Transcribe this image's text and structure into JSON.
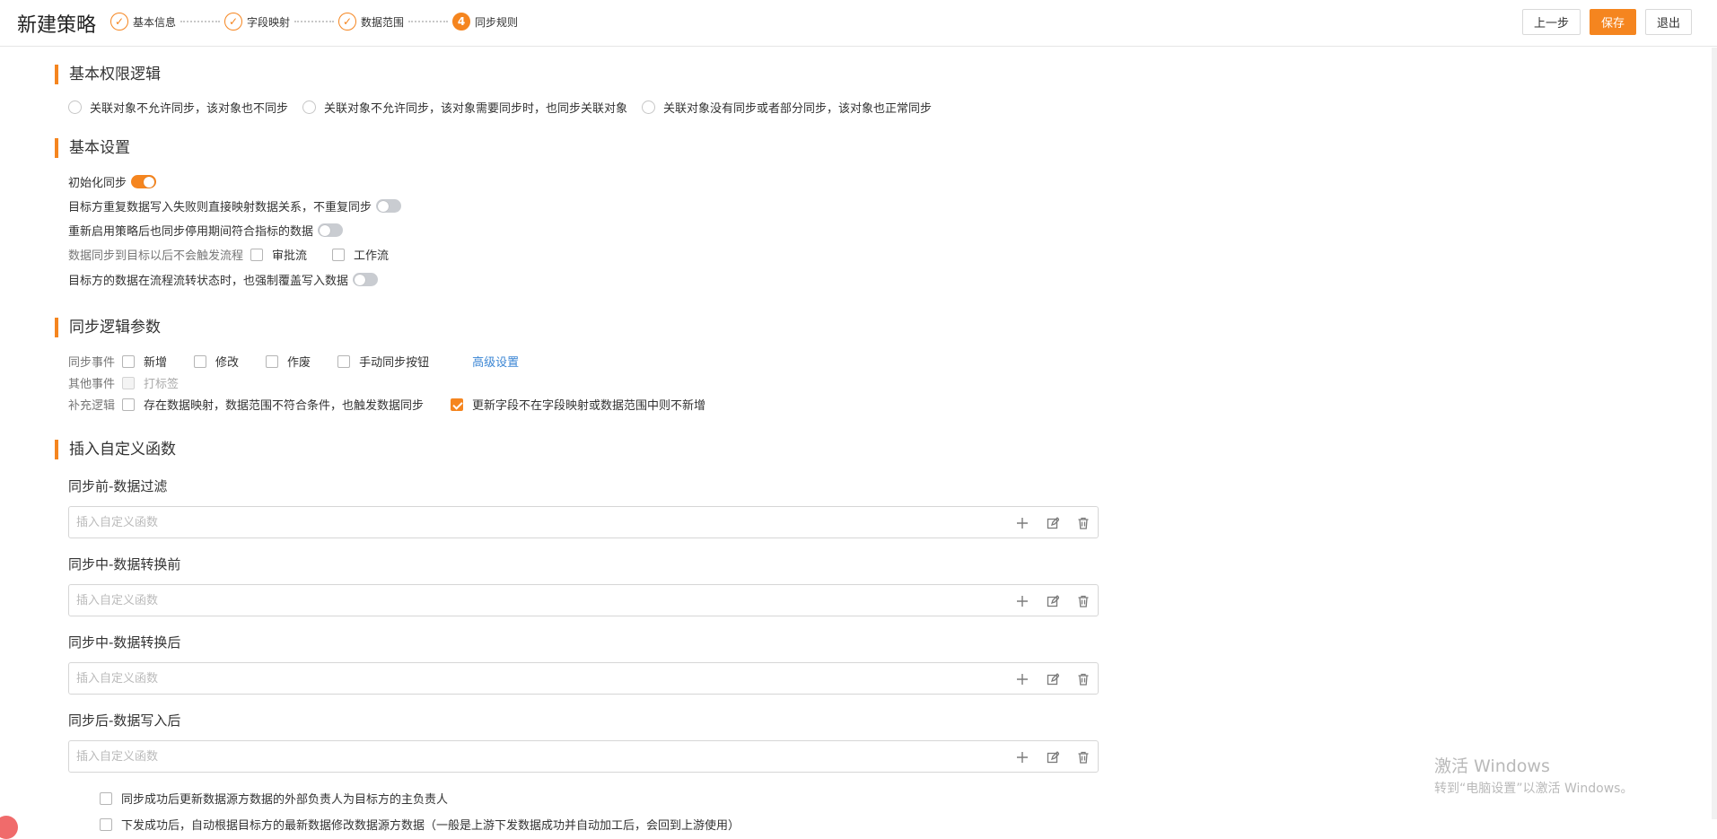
{
  "header": {
    "title": "新建策略",
    "steps": [
      {
        "label": "基本信息",
        "state": "done"
      },
      {
        "label": "字段映射",
        "state": "done"
      },
      {
        "label": "数据范围",
        "state": "done"
      },
      {
        "label": "同步规则",
        "state": "active",
        "number": "4"
      }
    ],
    "buttons": {
      "prev": "上一步",
      "save": "保存",
      "exit": "退出"
    }
  },
  "permission": {
    "title": "基本权限逻辑",
    "options": [
      "关联对象不允许同步，该对象也不同步",
      "关联对象不允许同步，该对象需要同步时，也同步关联对象",
      "关联对象没有同步或者部分同步，该对象也正常同步"
    ]
  },
  "basic": {
    "title": "基本设置",
    "init_sync": "初始化同步",
    "init_sync_on": true,
    "target_retry": "目标方重复数据写入失败则直接映射数据关系，不重复同步",
    "target_retry_on": false,
    "restart_sync": "重新启用策略后也同步停用期间符合指标的数据",
    "restart_sync_on": false,
    "no_flow": "数据同步到目标以后不会触发流程",
    "approval": "审批流",
    "workflow": "工作流",
    "force_overwrite": "目标方的数据在流程流转状态时，也强制覆盖写入数据",
    "force_overwrite_on": false
  },
  "logic": {
    "title": "同步逻辑参数",
    "events_label": "同步事件",
    "events": [
      "新增",
      "修改",
      "作废",
      "手动同步按钮"
    ],
    "advanced": "高级设置",
    "other_label": "其他事件",
    "other_event": "打标签",
    "supplement_label": "补充逻辑",
    "supplement_1": "存在数据映射，数据范围不符合条件，也触发数据同步",
    "supplement_2": "更新字段不在字段映射或数据范围中则不新增",
    "supplement_2_checked": true
  },
  "functions": {
    "title": "插入自定义函数",
    "placeholder": "插入自定义函数",
    "items": [
      "同步前-数据过滤",
      "同步中-数据转换前",
      "同步中-数据转换后",
      "同步后-数据写入后"
    ]
  },
  "footer_options": [
    "同步成功后更新数据源方数据的外部负责人为目标方的主负责人",
    "下发成功后，自动根据目标方的最新数据修改数据源方数据（一般是上游下发数据成功并自动加工后，会回到上游使用）"
  ],
  "watermark": {
    "title": "激活 Windows",
    "subtitle": "转到“电脑设置”以激活 Windows。"
  },
  "colors": {
    "accent": "#f5851f",
    "link": "#3b86d4"
  }
}
